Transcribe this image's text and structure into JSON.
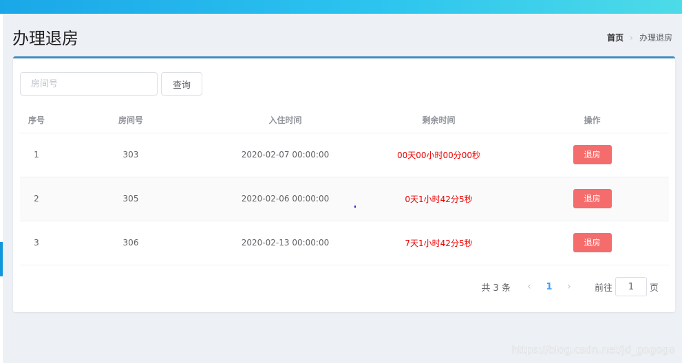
{
  "page": {
    "title": "办理退房",
    "breadcrumb": {
      "home": "首页",
      "separator": "›",
      "current": "办理退房"
    }
  },
  "search": {
    "placeholder": "房间号",
    "value": "",
    "button_label": "查询"
  },
  "table": {
    "headers": {
      "index": "序号",
      "room": "房间号",
      "checkin": "入住时间",
      "remaining": "剩余时间",
      "actions": "操作"
    },
    "rows": [
      {
        "index": "1",
        "room": "303",
        "checkin": "2020-02-07 00:00:00",
        "remaining": "00天00小时00分00秒",
        "action_label": "退房"
      },
      {
        "index": "2",
        "room": "305",
        "checkin": "2020-02-06 00:00:00",
        "remaining": "0天1小时42分5秒",
        "action_label": "退房"
      },
      {
        "index": "3",
        "room": "306",
        "checkin": "2020-02-13 00:00:00",
        "remaining": "7天1小时42分5秒",
        "action_label": "退房"
      }
    ]
  },
  "pagination": {
    "total_text": "共 3 条",
    "prev_icon": "chevron-left-icon",
    "next_icon": "chevron-right-icon",
    "current_page": "1",
    "goto_label": "前往",
    "goto_value": "1",
    "page_suffix": "页"
  },
  "watermark": "https://blog.csdn.net/jd_gogogo",
  "colors": {
    "accent": "#3c8dbc",
    "danger_button": "#f56c6c",
    "remaining_text": "#ee0000",
    "active_page": "#409eff"
  }
}
